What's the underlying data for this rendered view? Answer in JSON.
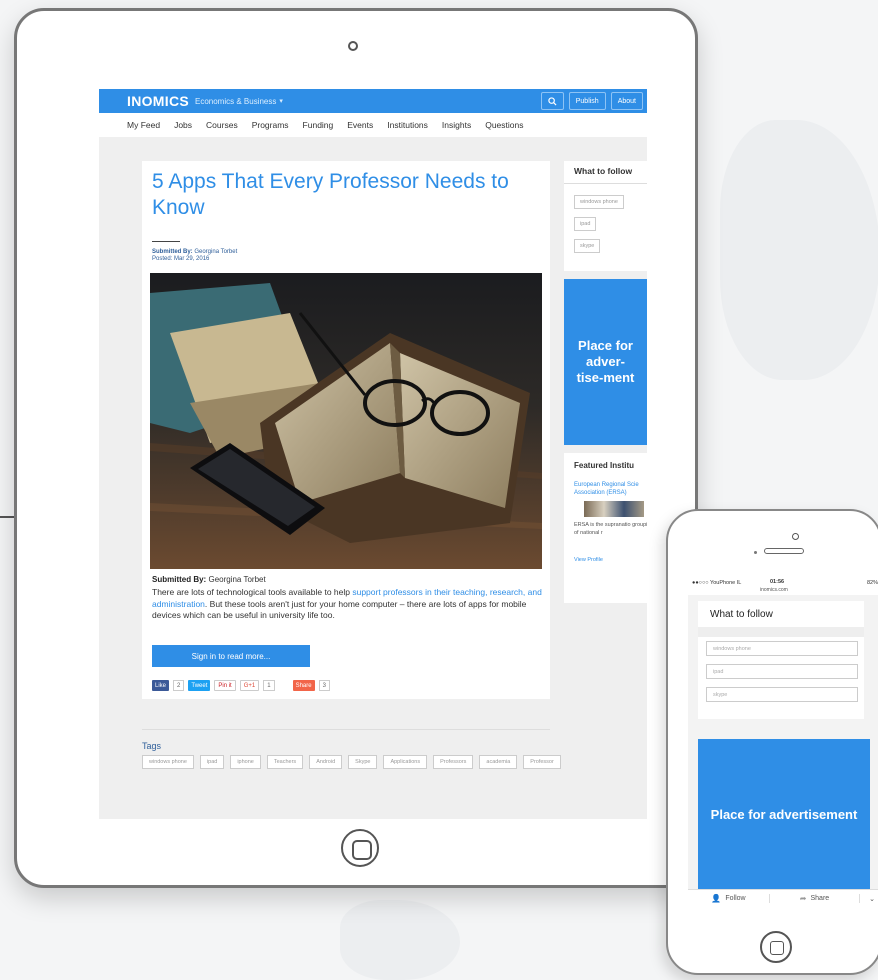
{
  "site": {
    "brand": "INOMICS",
    "section": "Economics & Business",
    "actions": [
      "Publish",
      "About"
    ]
  },
  "nav": [
    "My Feed",
    "Jobs",
    "Courses",
    "Programs",
    "Funding",
    "Events",
    "Institutions",
    "Insights",
    "Questions"
  ],
  "article": {
    "title": "5 Apps That Every Professor Needs to Know",
    "meta_submitted_label": "Submitted By:",
    "meta_author": "Georgina Torbet",
    "meta_posted": "Posted: Mar 29, 2016",
    "submitted_label": "Submitted By:",
    "author": "Georgina Torbet",
    "body_pre": "There are lots of technological tools available to help ",
    "body_link": "support professors in their teaching, research, and administration",
    "body_post": ". But these tools aren't just for your home computer – there are lots of apps for mobile devices which can be useful in university life too.",
    "signin_label": "Sign in to read more...",
    "share": {
      "like": "Like",
      "like_count": "2",
      "tweet": "Tweet",
      "pin": "Pin it",
      "gplus": "G+1",
      "gplus_count": "1",
      "share": "Share",
      "share_count": "3"
    }
  },
  "sidebar": {
    "follow_title": "What to follow",
    "follow_items": [
      "windows phone",
      "ipad",
      "skype"
    ],
    "ad_text": "Place for adver-tise-ment",
    "featured_title": "Featured Institu",
    "featured_link": "European Regional Scie Association (ERSA)",
    "featured_desc": "ERSA is the supranatio grouping of national r",
    "featured_view": "View Profile"
  },
  "tags": {
    "title": "Tags",
    "items": [
      "windows phone",
      "ipad",
      "iphone",
      "Teachers",
      "Android",
      "Skype",
      "Applications",
      "Professors",
      "academia",
      "Professor"
    ]
  },
  "phone": {
    "carrier": "●●○○○ YouPhone IL",
    "time": "01:56",
    "url": "inomics.com",
    "battery": "82%",
    "follow_title": "What to follow",
    "follow_items": [
      "windows phone",
      "ipad",
      "skype"
    ],
    "ad_text": "Place for advertisement",
    "follow_btn": "Follow",
    "share_btn": "Share"
  },
  "colors": {
    "accent": "#2f8ee6"
  }
}
